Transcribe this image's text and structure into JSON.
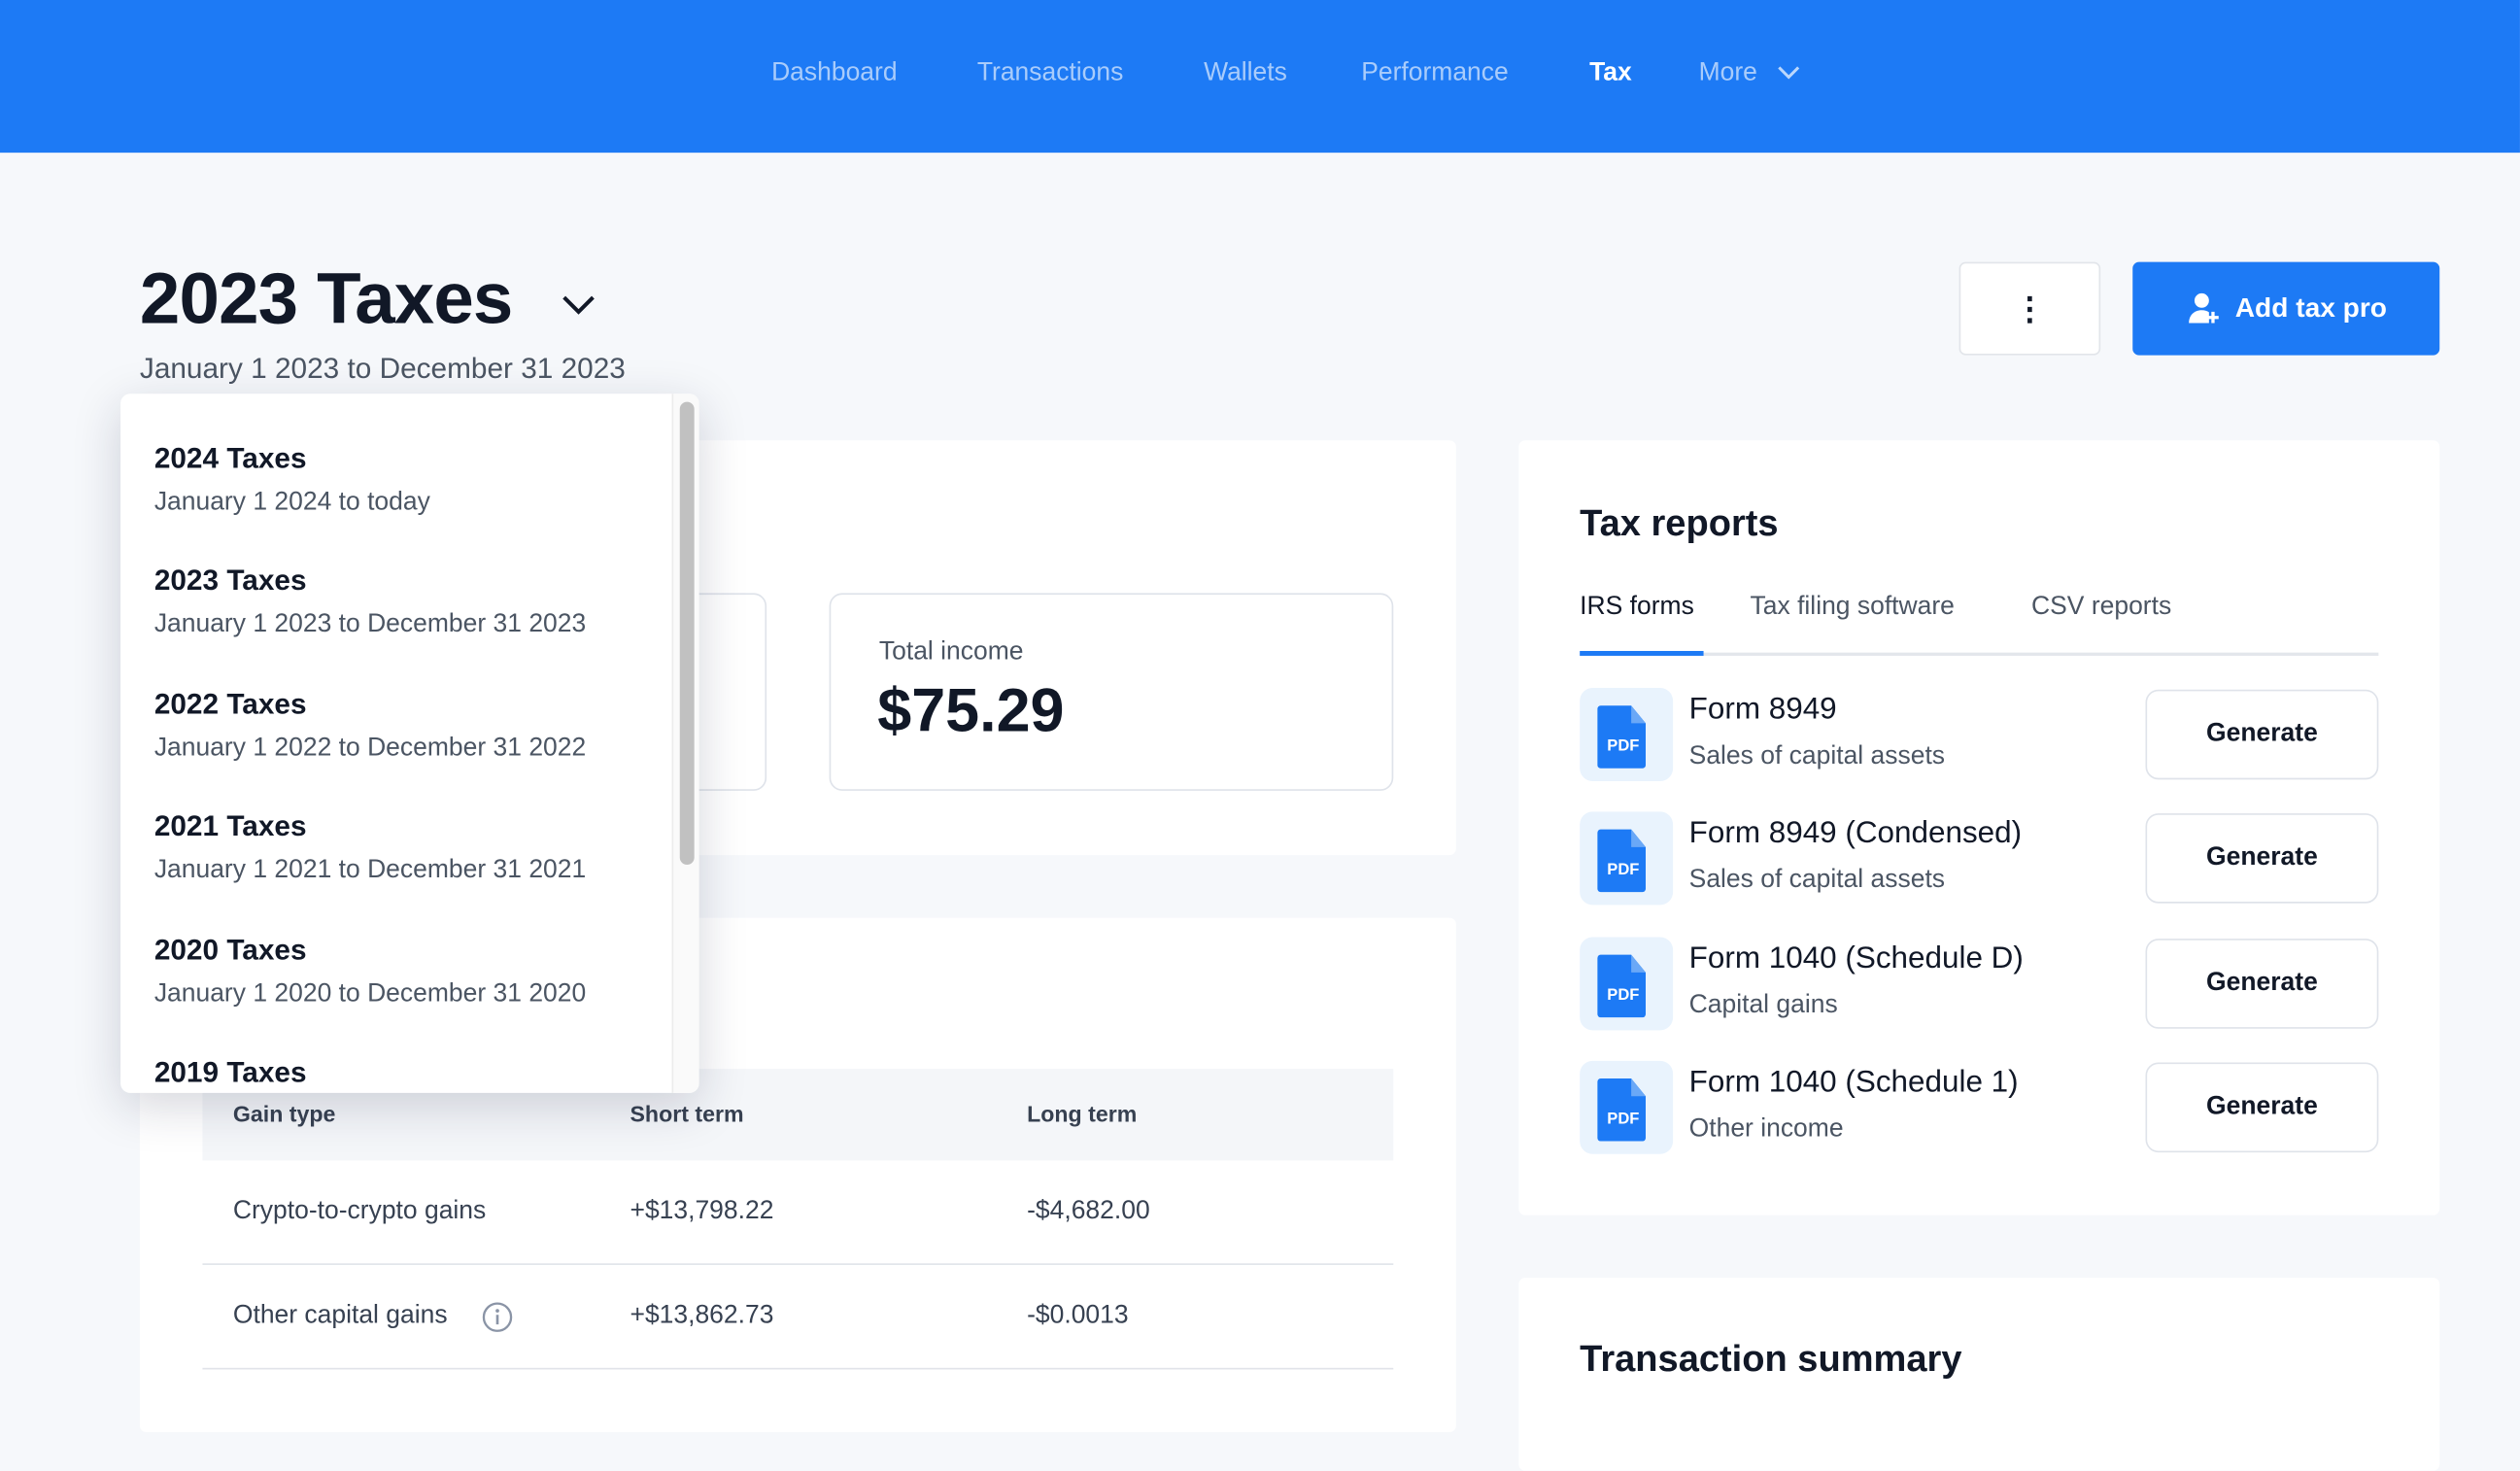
{
  "nav": {
    "items": [
      {
        "label": "Dashboard"
      },
      {
        "label": "Transactions"
      },
      {
        "label": "Wallets"
      },
      {
        "label": "Performance"
      },
      {
        "label": "Tax",
        "active": true
      },
      {
        "label": "More"
      }
    ]
  },
  "header": {
    "title": "2023 Taxes",
    "subtitle": "January 1 2023 to December 31 2023",
    "add_tax_pro": "Add tax pro",
    "more_icon": "vertical-ellipsis-icon"
  },
  "summary": {
    "total_income_label": "Total income",
    "total_income_value": "$75.29"
  },
  "gains_table": {
    "columns": [
      "Gain type",
      "Short term",
      "Long term"
    ],
    "rows": [
      {
        "type": "Crypto-to-crypto gains",
        "short": "+$13,798.22",
        "long": "-$4,682.00"
      },
      {
        "type": "Other capital gains",
        "short": "+$13,862.73",
        "long": "-$0.0013"
      }
    ]
  },
  "year_dropdown": {
    "items": [
      {
        "title": "2024 Taxes",
        "range": "January 1 2024 to today"
      },
      {
        "title": "2023 Taxes",
        "range": "January 1 2023 to December 31 2023"
      },
      {
        "title": "2022 Taxes",
        "range": "January 1 2022 to December 31 2022"
      },
      {
        "title": "2021 Taxes",
        "range": "January 1 2021 to December 31 2021"
      },
      {
        "title": "2020 Taxes",
        "range": "January 1 2020 to December 31 2020"
      },
      {
        "title": "2019 Taxes"
      }
    ]
  },
  "tax_reports": {
    "title": "Tax reports",
    "tabs": [
      {
        "label": "IRS forms",
        "active": true
      },
      {
        "label": "Tax filing software"
      },
      {
        "label": "CSV reports"
      }
    ],
    "pdf_label": "PDF",
    "generate_label": "Generate",
    "forms": [
      {
        "name": "Form 8949",
        "desc": "Sales of capital assets"
      },
      {
        "name": "Form 8949 (Condensed)",
        "desc": "Sales of capital assets"
      },
      {
        "name": "Form 1040 (Schedule D)",
        "desc": "Capital gains"
      },
      {
        "name": "Form 1040 (Schedule 1)",
        "desc": "Other income"
      }
    ]
  },
  "transaction_summary": {
    "title": "Transaction summary"
  },
  "colors": {
    "brand": "#1d7af5",
    "background": "#f6f8fb",
    "text": "#111827"
  }
}
